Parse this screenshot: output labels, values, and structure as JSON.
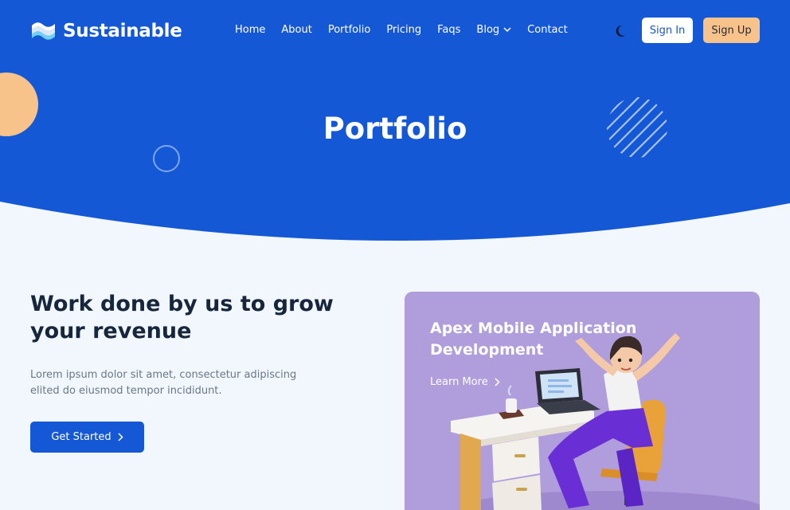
{
  "brand": {
    "name": "Sustainable"
  },
  "nav": {
    "items": [
      {
        "label": "Home"
      },
      {
        "label": "About"
      },
      {
        "label": "Portfolio"
      },
      {
        "label": "Pricing"
      },
      {
        "label": "Faqs"
      },
      {
        "label": "Blog"
      },
      {
        "label": "Contact"
      }
    ],
    "sign_in": "Sign In",
    "sign_up": "Sign Up"
  },
  "hero": {
    "title": "Portfolio"
  },
  "intro": {
    "heading": "Work done by us to grow your revenue",
    "description": "Lorem ipsum dolor sit amet, consectetur adipiscing elited do eiusmod tempor incididunt.",
    "cta": "Get Started"
  },
  "card": {
    "title": "Apex Mobile Application Development",
    "link": "Learn More"
  },
  "colors": {
    "primary": "#1558d6",
    "accent": "#f8c38b",
    "background": "#f1f7fc",
    "card": "#b09ddc",
    "heading": "#16263c"
  }
}
